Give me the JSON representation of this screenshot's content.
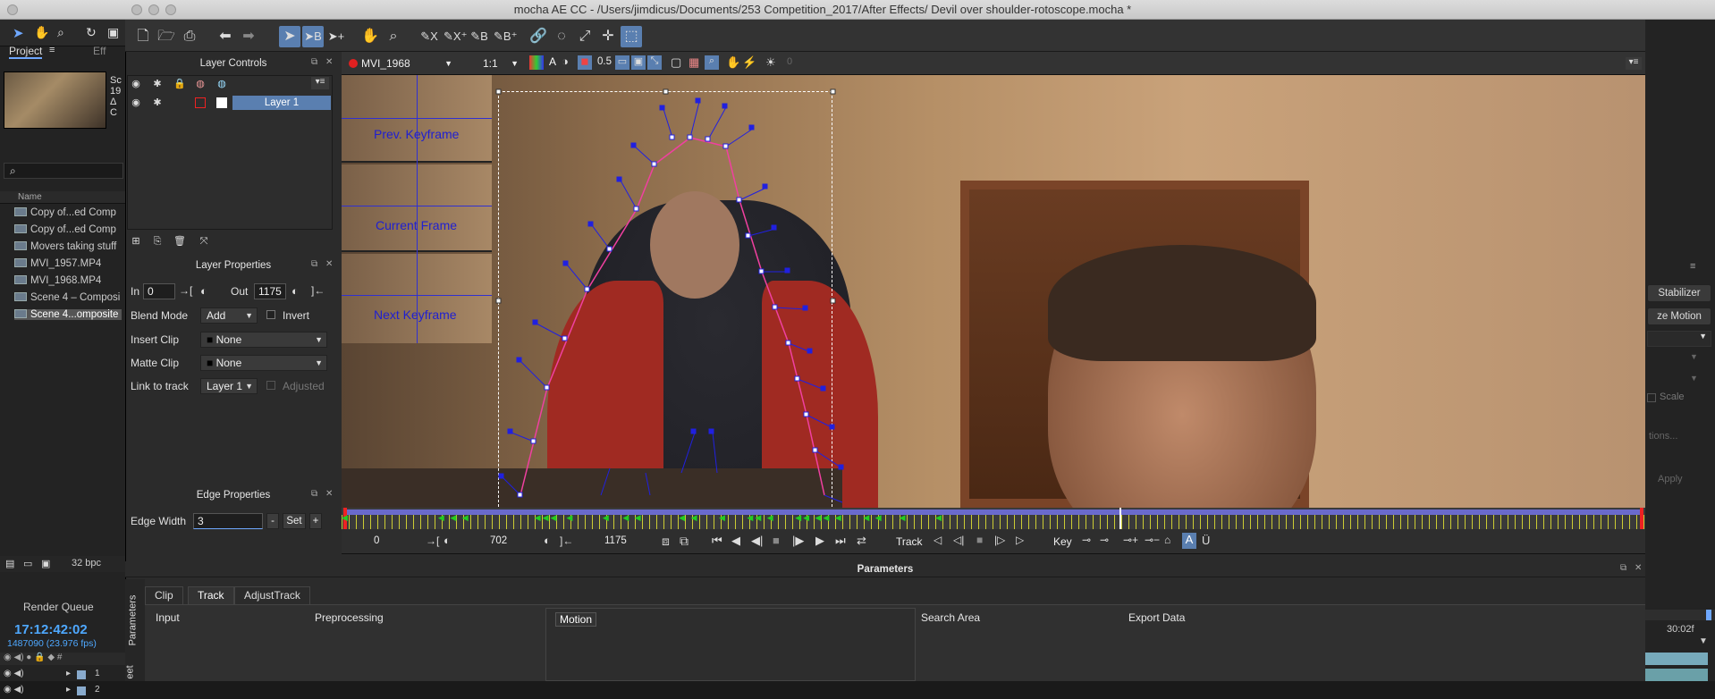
{
  "window": {
    "title": "mocha AE CC - /Users/jimdicus/Documents/253 Competition_2017/After Effects/ Devil over shoulder-rotoscope.mocha *"
  },
  "ae_left": {
    "tab_project": "Project",
    "tab_effects": "Eff",
    "thumb_info_1": "Sc",
    "thumb_info_2": "19",
    "thumb_info_3": "Δ C",
    "search_placeholder": "",
    "column_name": "Name",
    "files": [
      "Copy of...ed Comp",
      "Copy of...ed Comp",
      "Movers taking stuff",
      "MVI_1957.MP4",
      "MVI_1968.MP4",
      "Scene 4 – Composi",
      "Scene 4...omposite"
    ],
    "bpc": "32 bpc",
    "render_queue": "Render Queue",
    "timecode": "17:12:42:02",
    "frame_info": "1487090 (23.976 fps)",
    "layer_nums": [
      "1",
      "2"
    ]
  },
  "layer_controls": {
    "header": "Layer Controls",
    "layer_name": "Layer 1"
  },
  "layer_properties": {
    "header": "Layer Properties",
    "in_label": "In",
    "in_value": "0",
    "out_label": "Out",
    "out_value": "1175",
    "blend_label": "Blend Mode",
    "blend_value": "Add",
    "invert_label": "Invert",
    "insert_label": "Insert Clip",
    "insert_value": "None",
    "matte_label": "Matte Clip",
    "matte_value": "None",
    "link_label": "Link to track",
    "link_value": "Layer 1",
    "adjusted_label": "Adjusted"
  },
  "edge_properties": {
    "header": "Edge Properties",
    "width_label": "Edge Width",
    "width_value": "3",
    "minus": "-",
    "set": "Set",
    "plus": "+"
  },
  "viewer": {
    "clip_name": "MVI_1968",
    "zoom": "1:1",
    "opacity": "0.5",
    "extra_value": "0",
    "overlay_prev": "Prev. Keyframe",
    "overlay_current": "Current Frame",
    "overlay_next": "Next Keyframe"
  },
  "transport": {
    "start_frame": "0",
    "current_frame": "702",
    "end_frame": "1175",
    "track_label": "Track",
    "key_label": "Key"
  },
  "parameters": {
    "header": "Parameters",
    "side_tab_1": "Parameters",
    "side_tab_2": "eet",
    "tabs": [
      "Clip",
      "Track",
      "AdjustTrack"
    ],
    "active_tab": "Track",
    "sections": [
      "Input",
      "Preprocessing",
      "Motion",
      "Search Area",
      "Export Data"
    ]
  },
  "ae_right": {
    "stabilizer": "Stabilizer",
    "motion": "ze Motion",
    "scale": "Scale",
    "options": "tions...",
    "apply": "Apply",
    "time": "30:02f"
  }
}
